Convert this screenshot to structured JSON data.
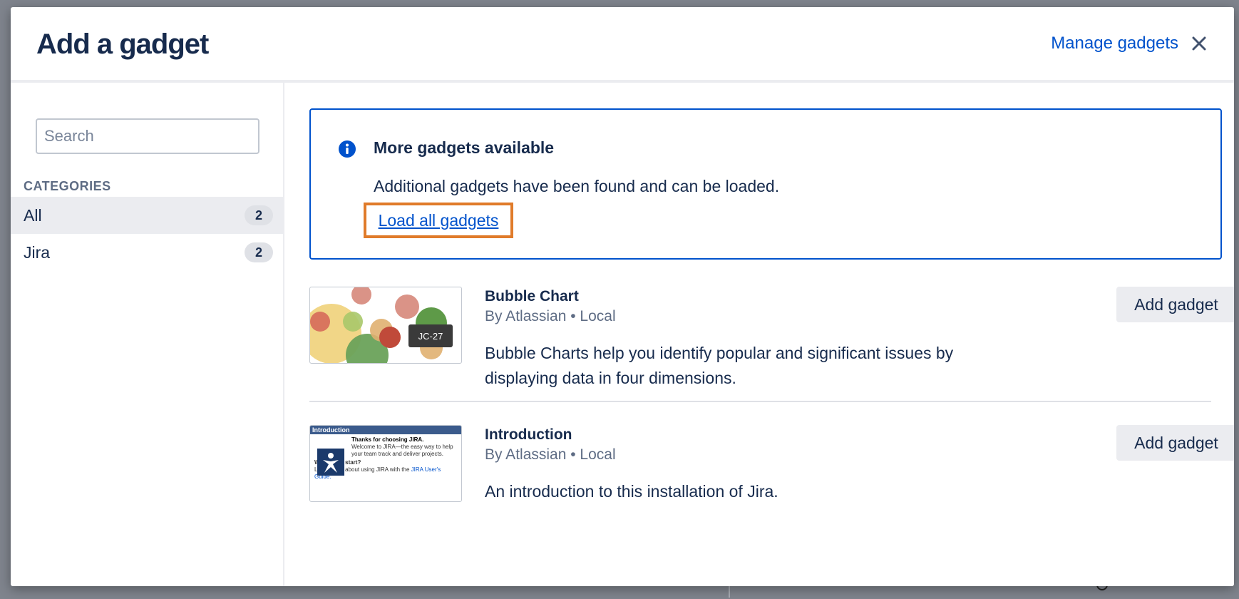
{
  "modal": {
    "title": "Add a gadget",
    "manage_link": "Manage gadgets",
    "close_label": "×"
  },
  "sidebar": {
    "search_placeholder": "Search",
    "categories_heading": "CATEGORIES",
    "categories": [
      {
        "label": "All",
        "count": "2",
        "active": true
      },
      {
        "label": "Jira",
        "count": "2",
        "active": false
      }
    ]
  },
  "info": {
    "title": "More gadgets available",
    "text": "Additional gadgets have been found and can be loaded.",
    "link": "Load all gadgets"
  },
  "gadgets": [
    {
      "title": "Bubble Chart",
      "meta": "By Atlassian • Local",
      "description": "Bubble Charts help you identify popular and significant issues by displaying data in four dimensions.",
      "button": "Add gadget",
      "thumb_tooltip": "JC-27"
    },
    {
      "title": "Introduction",
      "meta": "By Atlassian • Local",
      "description": "An introduction to this installation of Jira.",
      "button": "Add gadget",
      "thumb": {
        "header": "Introduction",
        "line1": "Thanks for choosing JIRA.",
        "line2": "Welcome to JIRA—the easy way to help your team track and deliver projects.",
        "question": "Where do I start?",
        "line3": "Learn more about using JIRA with the",
        "link": "JIRA User's Guide."
      }
    }
  ],
  "colors": {
    "link": "#0052cc",
    "highlight_border": "#e07b2a",
    "text": "#172b4d"
  }
}
